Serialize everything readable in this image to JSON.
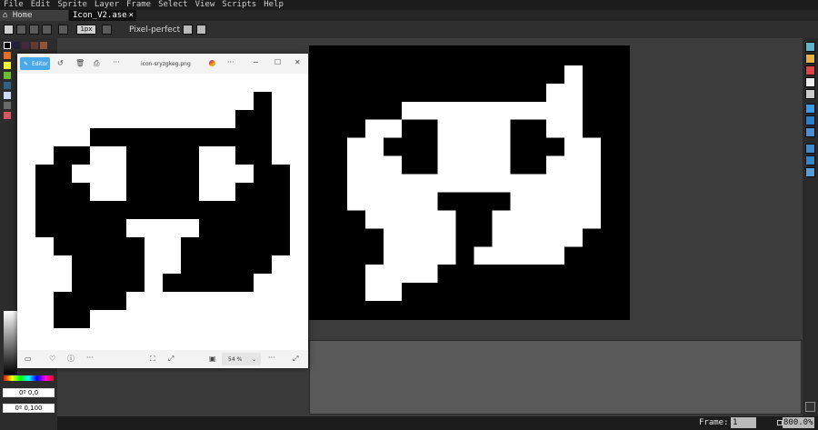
{
  "menu": [
    "File",
    "Edit",
    "Sprite",
    "Layer",
    "Frame",
    "Select",
    "View",
    "Scripts",
    "Help"
  ],
  "tabs": [
    {
      "label": "Home",
      "icon": "home-icon"
    },
    {
      "label": "Icon_V2.ase",
      "close": "×"
    }
  ],
  "toolbar": {
    "pixel_perfect": "Pixel-perfect",
    "brush_size": "1px"
  },
  "left_panel": {
    "color_field_1": "0º 0,0",
    "color_field_2": "0º 0,100"
  },
  "viewer": {
    "editor_label": "Editor",
    "filename": "icon-sryzgkeg.png",
    "more": "···",
    "zoom": "54 %"
  },
  "status": {
    "frame_label": "Frame:",
    "frame_value": "1",
    "zoom_value": "800.0%"
  },
  "colors": {
    "accent": "#4aa8e8",
    "sprite_fg": "#ffffff",
    "sprite_bg": "#000000"
  }
}
